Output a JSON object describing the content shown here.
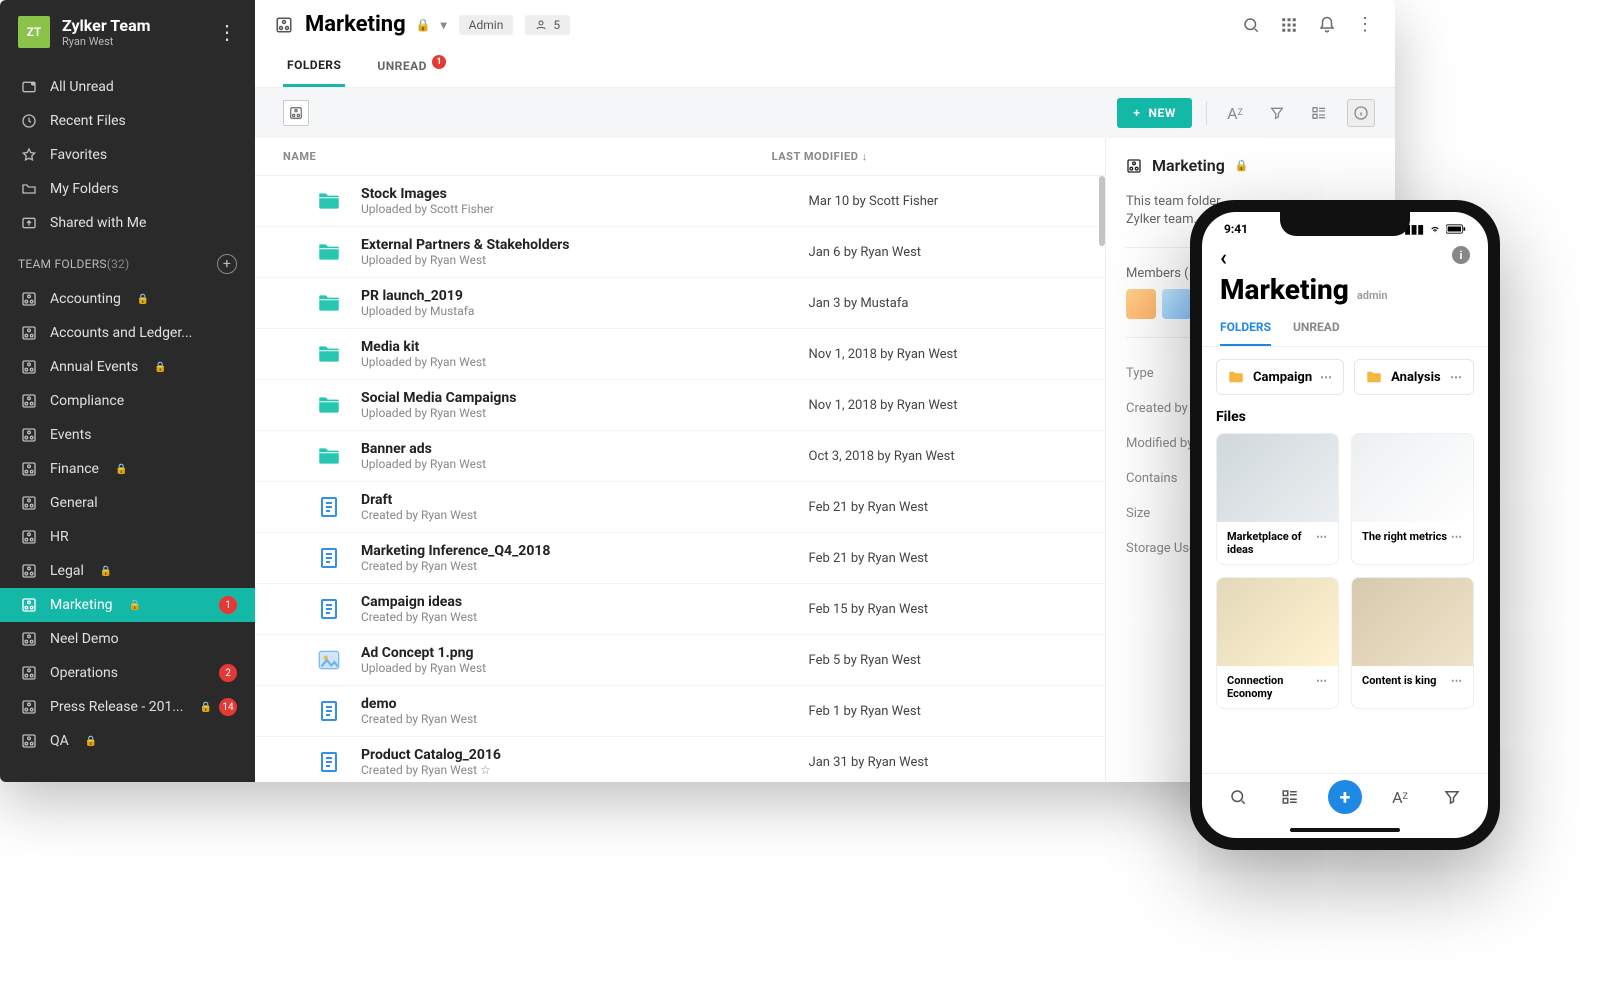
{
  "team": {
    "avatar": "ZT",
    "name": "Zylker Team",
    "user": "Ryan West"
  },
  "nav": {
    "allUnread": "All Unread",
    "recent": "Recent Files",
    "favorites": "Favorites",
    "myFolders": "My Folders",
    "shared": "Shared with Me"
  },
  "teamFoldersLabel": "TEAM FOLDERS",
  "teamFoldersCount": "(32)",
  "folders": [
    {
      "label": "Accounting",
      "locked": true
    },
    {
      "label": "Accounts and Ledger..."
    },
    {
      "label": "Annual Events",
      "locked": true
    },
    {
      "label": "Compliance"
    },
    {
      "label": "Events"
    },
    {
      "label": "Finance",
      "locked": true
    },
    {
      "label": "General"
    },
    {
      "label": "HR"
    },
    {
      "label": "Legal",
      "locked": true
    },
    {
      "label": "Marketing",
      "locked": true,
      "active": true,
      "badge": "1"
    },
    {
      "label": "Neel Demo"
    },
    {
      "label": "Operations",
      "badge": "2"
    },
    {
      "label": "Press Release - 201...",
      "locked": true,
      "badge": "14"
    },
    {
      "label": "QA",
      "locked": true
    }
  ],
  "header": {
    "title": "Marketing",
    "adminChip": "Admin",
    "membersChip": "5"
  },
  "tabs": {
    "folders": "FOLDERS",
    "unread": "UNREAD",
    "unreadBadge": "1"
  },
  "newBtn": "NEW",
  "columns": {
    "name": "NAME",
    "modified": "LAST MODIFIED"
  },
  "files": [
    {
      "type": "folder",
      "name": "Stock Images",
      "sub": "Uploaded by Scott Fisher",
      "mod": "Mar 10 by Scott Fisher"
    },
    {
      "type": "folder",
      "name": "External Partners & Stakeholders",
      "sub": "Uploaded by Ryan West",
      "mod": "Jan 6 by Ryan West"
    },
    {
      "type": "folder",
      "name": "PR launch_2019",
      "sub": "Uploaded by Mustafa",
      "mod": "Jan 3 by Mustafa"
    },
    {
      "type": "folder",
      "name": "Media kit",
      "sub": "Uploaded by Ryan West",
      "mod": "Nov 1, 2018 by Ryan West"
    },
    {
      "type": "folder",
      "name": "Social Media Campaigns",
      "sub": "Uploaded by Ryan West",
      "mod": "Nov 1, 2018 by Ryan West"
    },
    {
      "type": "folder",
      "name": "Banner ads",
      "sub": "Uploaded by Ryan West",
      "mod": "Oct 3, 2018 by Ryan West"
    },
    {
      "type": "doc",
      "name": "Draft",
      "sub": "Created by Ryan West",
      "mod": "Feb 21 by Ryan West"
    },
    {
      "type": "doc",
      "name": "Marketing Inference_Q4_2018",
      "sub": "Created by Ryan West",
      "mod": "Feb 21 by Ryan West"
    },
    {
      "type": "doc",
      "name": "Campaign ideas",
      "sub": "Created by Ryan West",
      "mod": "Feb 15 by Ryan West"
    },
    {
      "type": "image",
      "name": "Ad Concept 1.png",
      "sub": "Uploaded by Ryan West",
      "mod": "Feb 5 by Ryan West"
    },
    {
      "type": "doc",
      "name": "demo",
      "sub": "Created by Ryan West",
      "mod": "Feb 1 by Ryan West"
    },
    {
      "type": "doc",
      "name": "Product Catalog_2016",
      "sub": "Created by Ryan West  ☆",
      "mod": "Jan 31 by Ryan West"
    }
  ],
  "details": {
    "title": "Marketing",
    "desc": "This team folder ... Zylker team.",
    "descLine1": "This team folder",
    "descLine2": "Zylker team.",
    "membersLabel": "Members (5)",
    "rows": [
      "Type",
      "Created by",
      "Modified by",
      "Contains",
      "Size",
      "Storage Used"
    ]
  },
  "mobile": {
    "time": "9:41",
    "title": "Marketing",
    "admin": "admin",
    "tabs": {
      "folders": "FOLDERS",
      "unread": "UNREAD"
    },
    "folders": [
      {
        "name": "Campaign"
      },
      {
        "name": "Analysis"
      }
    ],
    "filesLabel": "Files",
    "cards": [
      {
        "caption": "Marketplace of ideas"
      },
      {
        "caption": "The right metrics"
      },
      {
        "caption": "Connection Economy"
      },
      {
        "caption": "Content is king"
      }
    ]
  }
}
